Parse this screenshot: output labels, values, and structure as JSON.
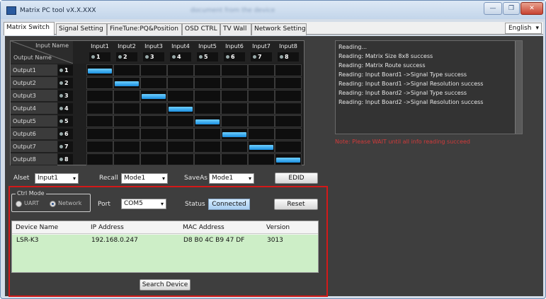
{
  "window": {
    "title": "Matrix PC tool vX.X.XXX",
    "title_blurred": "document from the device",
    "buttons": {
      "min": "—",
      "max": "❐",
      "close": "✕"
    }
  },
  "tabs": [
    {
      "label": "Matrix Switch",
      "active": true
    },
    {
      "label": "Signal Setting",
      "active": false
    },
    {
      "label": "FineTune:PQ&Position",
      "active": false
    },
    {
      "label": "OSD CTRL",
      "active": false
    },
    {
      "label": "TV Wall",
      "active": false
    },
    {
      "label": "Network Setting",
      "active": false
    }
  ],
  "language": {
    "value": "English",
    "arrow": "▾"
  },
  "matrix": {
    "corner_input": "Input Name",
    "corner_output": "Output Name",
    "inputs": [
      {
        "label": "Input1",
        "num": "1"
      },
      {
        "label": "Input2",
        "num": "2"
      },
      {
        "label": "Input3",
        "num": "3"
      },
      {
        "label": "Input4",
        "num": "4"
      },
      {
        "label": "Input5",
        "num": "5"
      },
      {
        "label": "Input6",
        "num": "6"
      },
      {
        "label": "Input7",
        "num": "7"
      },
      {
        "label": "Input8",
        "num": "8"
      }
    ],
    "outputs": [
      {
        "label": "Output1",
        "num": "1",
        "route": 1
      },
      {
        "label": "Output2",
        "num": "2",
        "route": 2
      },
      {
        "label": "Output3",
        "num": "3",
        "route": 3
      },
      {
        "label": "Output4",
        "num": "4",
        "route": 4
      },
      {
        "label": "Output5",
        "num": "5",
        "route": 5
      },
      {
        "label": "Output6",
        "num": "6",
        "route": 6
      },
      {
        "label": "Output7",
        "num": "7",
        "route": 7
      },
      {
        "label": "Output8",
        "num": "8",
        "route": 8
      }
    ],
    "route_color": "#1b8fe0"
  },
  "log": {
    "lines": [
      "Reading...",
      "Reading: Matrix Size 8x8 success",
      "Reading: Matrix Route success",
      "Reading: Input Board1 ->Signal Type success",
      "Reading: Input Board1 ->Signal Resolution success",
      "Reading: Input Board2 ->Signal Type success",
      "Reading: Input Board2 ->Signal Resolution success"
    ],
    "note": "Note: Please WAIT until all info reading succeed"
  },
  "controls": {
    "allset_label": "Alset",
    "allset_value": "Input1",
    "recall_label": "Recall",
    "recall_value": "Mode1",
    "saveas_label": "SaveAs",
    "saveas_value": "Mode1",
    "edid_button": "EDID",
    "arrow": "▾"
  },
  "connection": {
    "ctrl_mode_label": "Ctrl Mode",
    "uart_label": "UART",
    "network_label": "Network",
    "selected": "Network",
    "port_label": "Port",
    "port_value": "COM5",
    "status_label": "Status",
    "status_value": "Connected",
    "reset_button": "Reset"
  },
  "device_table": {
    "headers": [
      "Device Name",
      "IP Address",
      "MAC Address",
      "Version"
    ],
    "rows": [
      [
        "LSR-K3",
        "192.168.0.247",
        "D8 B0 4C B9 47 DF",
        "3013"
      ]
    ],
    "search_button": "Search Device",
    "selected_row_color": "#cdeec7"
  }
}
